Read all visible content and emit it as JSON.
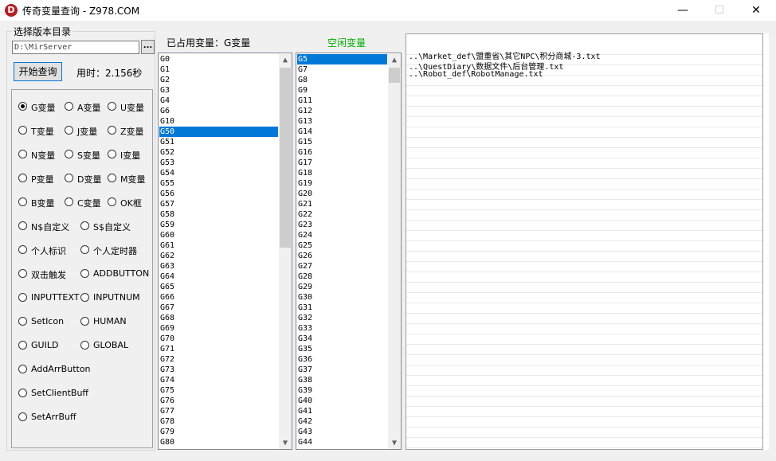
{
  "window": {
    "title": "传奇变量查询 - Z978.COM",
    "icon_letter": "D",
    "minimize": "—",
    "maximize": "☐",
    "close": "✕"
  },
  "left": {
    "group_title": "选择版本目录",
    "path_value": "D:\\MirServer",
    "browse_label": "...",
    "start_button": "开始查询",
    "elapsed": "用时：2.156秒",
    "radios": [
      {
        "label": "G变量",
        "checked": true
      },
      {
        "label": "A变量"
      },
      {
        "label": "U变量"
      },
      {
        "label": "T变量"
      },
      {
        "label": "J变量"
      },
      {
        "label": "Z变量"
      },
      {
        "label": "N变量"
      },
      {
        "label": "S变量"
      },
      {
        "label": "I变量"
      },
      {
        "label": "P变量"
      },
      {
        "label": "D变量"
      },
      {
        "label": "M变量"
      },
      {
        "label": "B变量"
      },
      {
        "label": "C变量"
      },
      {
        "label": "OK框"
      },
      {
        "label": "N$自定义"
      },
      {
        "label": "S$自定义"
      },
      {
        "label": "个人标识"
      },
      {
        "label": "个人定时器"
      },
      {
        "label": "双击触发"
      },
      {
        "label": "ADDBUTTON"
      },
      {
        "label": "INPUTTEXT"
      },
      {
        "label": "INPUTNUM"
      },
      {
        "label": "SetIcon"
      },
      {
        "label": "HUMAN"
      },
      {
        "label": "GUILD"
      },
      {
        "label": "GLOBAL"
      },
      {
        "label": "AddArrButton"
      },
      {
        "label": "SetClientBuff"
      },
      {
        "label": "SetArrBuff"
      }
    ]
  },
  "used": {
    "label": "已占用变量：G变量",
    "selected_index": 7,
    "items": [
      "G0",
      "G1",
      "G2",
      "G3",
      "G4",
      "G6",
      "G10",
      "G50",
      "G51",
      "G52",
      "G53",
      "G54",
      "G55",
      "G56",
      "G57",
      "G58",
      "G59",
      "G60",
      "G61",
      "G62",
      "G63",
      "G64",
      "G65",
      "G66",
      "G67",
      "G68",
      "G69",
      "G70",
      "G71",
      "G72",
      "G73",
      "G74",
      "G75",
      "G76",
      "G77",
      "G78",
      "G79",
      "G80"
    ]
  },
  "free": {
    "label": "空闲变量",
    "label_color": "#00b000",
    "selected_index": 0,
    "items": [
      "G5",
      "G7",
      "G8",
      "G9",
      "G11",
      "G12",
      "G13",
      "G14",
      "G15",
      "G16",
      "G17",
      "G18",
      "G19",
      "G20",
      "G21",
      "G22",
      "G23",
      "G24",
      "G25",
      "G26",
      "G27",
      "G28",
      "G29",
      "G30",
      "G31",
      "G32",
      "G33",
      "G34",
      "G35",
      "G36",
      "G37",
      "G38",
      "G39",
      "G40",
      "G41",
      "G42",
      "G43",
      "G44"
    ]
  },
  "results": [
    "..\\Market_def\\盟重省\\其它NPC\\积分商城-3.txt",
    "..\\QuestDiary\\数据文件\\后台管理.txt",
    "..\\Robot_def\\RobotManage.txt"
  ],
  "scroll": {
    "up": "▲",
    "down": "▼"
  }
}
